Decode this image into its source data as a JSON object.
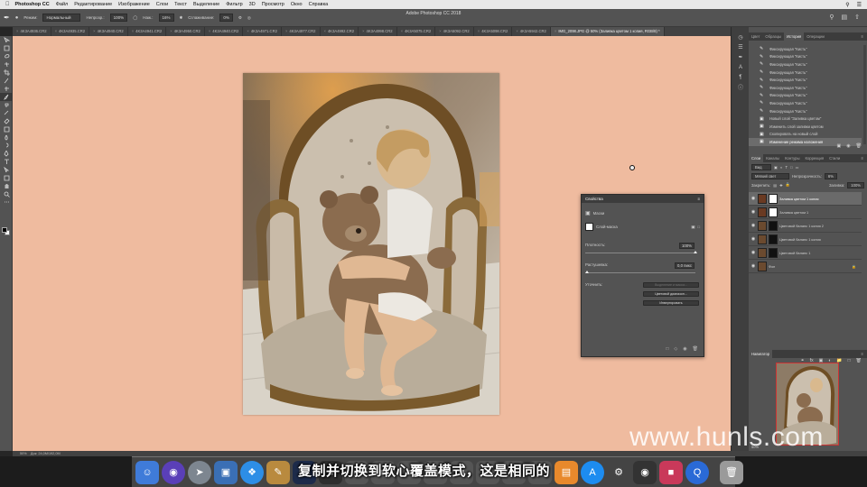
{
  "menubar": {
    "app_name": "Photoshop CC",
    "items": [
      "Файл",
      "Редактирование",
      "Изображение",
      "Слои",
      "Текст",
      "Выделение",
      "Фильтр",
      "3D",
      "Просмотр",
      "Окно",
      "Справка"
    ]
  },
  "window": {
    "title": "Adobe Photoshop CC 2018"
  },
  "options": {
    "mode_label": "Режим:",
    "mode_value": "Нормальный",
    "opacity_label": "Непрозр.:",
    "opacity_value": "100%",
    "flow_label": "Наж.:",
    "flow_value": "16%",
    "smoothing_label": "Сглаживание:",
    "smoothing_value": "0%"
  },
  "tabs": [
    "4K3A4936.CR2",
    "4K3A4935.CR2",
    "4K3A4940.CR2",
    "4K3A4941.CR2",
    "4K3A4950.CR2",
    "4K3A4940.CR2",
    "4K3A4971.CR2",
    "4K3A4977.CR2",
    "4K3A4992.CR2",
    "4K3A4998.CR2",
    "4K3A5075.CR2",
    "4K3A5092.CR2",
    "4K3A5098.CR2",
    "4K3A5942.CR2",
    "IMG_2098.JPG @ 50% (Заливка цветом 1 копия, RGB/8) *"
  ],
  "properties": {
    "title": "Свойства",
    "section": "Маски",
    "mask_label": "Слой-маска",
    "density_label": "Плотность:",
    "density_value": "100%",
    "feather_label": "Растушевка:",
    "feather_value": "0,0 пикс",
    "refine_label": "Уточнить:",
    "btn_select_mask": "Выделение и маска...",
    "btn_color_range": "Цветовой диапазон...",
    "btn_invert": "Инвертировать"
  },
  "history": {
    "tabs": [
      "Цвет",
      "Образцы",
      "История",
      "Операции"
    ],
    "items": [
      "Фиксирующая \"Кисть\"",
      "Фиксирующая \"Кисть\"",
      "Фиксирующая \"Кисть\"",
      "Фиксирующая \"Кисть\"",
      "Фиксирующая \"Кисть\"",
      "Фиксирующая \"Кисть\"",
      "Фиксирующая \"Кисть\"",
      "Фиксирующая \"Кисть\"",
      "Фиксирующая \"Кисть\"",
      "Новый слой \"Заливка цветом\"",
      "Изменить слой заливки цветом",
      "Скопировать на новый слой",
      "Изменение режима наложения"
    ]
  },
  "layers": {
    "tabs": [
      "Слои",
      "Каналы",
      "Контуры",
      "Коррекция",
      "Стили"
    ],
    "filter": "Вид",
    "blend_mode": "Мягкий свет",
    "opacity_label": "Непрозрачность:",
    "opacity_value": "6%",
    "lock_label": "Закрепить:",
    "fill_label": "Заливка:",
    "fill_value": "100%",
    "items": [
      "Заливка цветом 1 копия",
      "Заливка цветом 1",
      "Цветовой баланс 1 копия 2",
      "Цветовой баланс 1 копия",
      "Цветовой баланс 1",
      "Фон"
    ]
  },
  "navigator": {
    "title": "Навигатор",
    "zoom": "50%"
  },
  "status": {
    "zoom": "50%",
    "doc": "Док: 24,0M/192,0M"
  },
  "subtitle": "复制并切换到软心覆盖模式，这是相同的",
  "watermark": "www.hunls.com",
  "colors": {
    "canvas_fill": "#efbb9f",
    "panel": "#535353",
    "dark_panel": "#3c3c3c"
  }
}
